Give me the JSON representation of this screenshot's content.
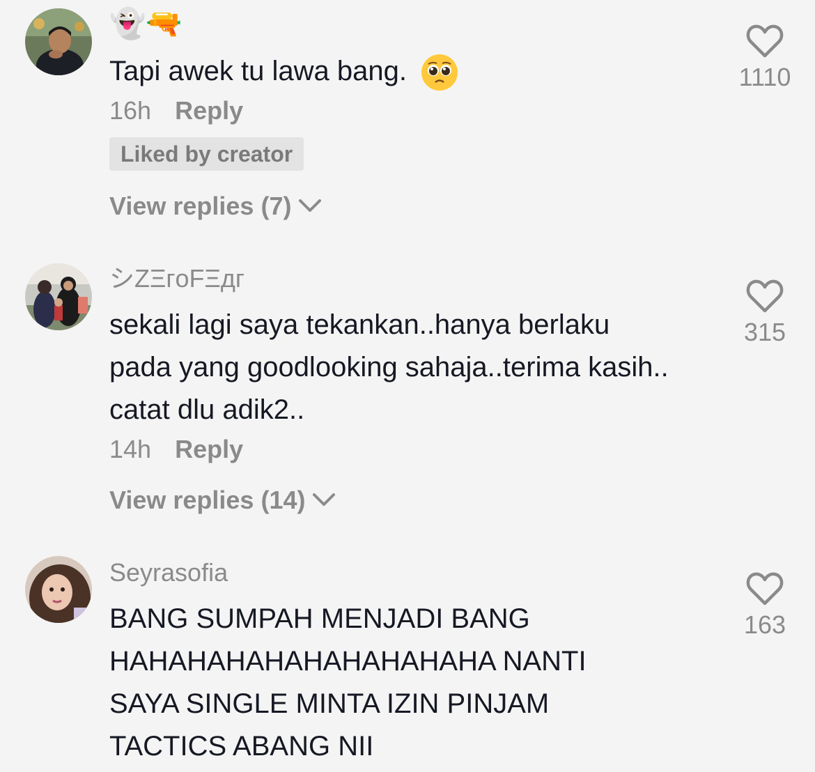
{
  "comments": [
    {
      "username": "👻🔫",
      "text": "Tapi awek tu lawa bang.",
      "text_emoji": "pleading-face",
      "time": "16h",
      "reply_label": "Reply",
      "liked_badge": "Liked by creator",
      "view_replies": "View replies (7)",
      "likes": "1110"
    },
    {
      "username": "シZΞгoFΞдг",
      "text": "sekali lagi saya tekankan..hanya berlaku pada yang goodlooking sahaja..terima kasih.. catat dlu adik2..",
      "time": "14h",
      "reply_label": "Reply",
      "view_replies": "View replies (14)",
      "likes": "315"
    },
    {
      "username": "Seyrasofia",
      "text": "BANG SUMPAH MENJADI BANG HAHAHAHAHAHAHAHAHAHA NANTI SAYA SINGLE MINTA IZIN PINJAM TACTICS ABANG NII",
      "likes": "163"
    }
  ],
  "icons": {
    "like": "heart-outline-icon",
    "expand": "chevron-down-icon"
  },
  "colors": {
    "background": "#f4f4f4",
    "primary_text": "#161823",
    "secondary_text": "#8a8a8a"
  }
}
